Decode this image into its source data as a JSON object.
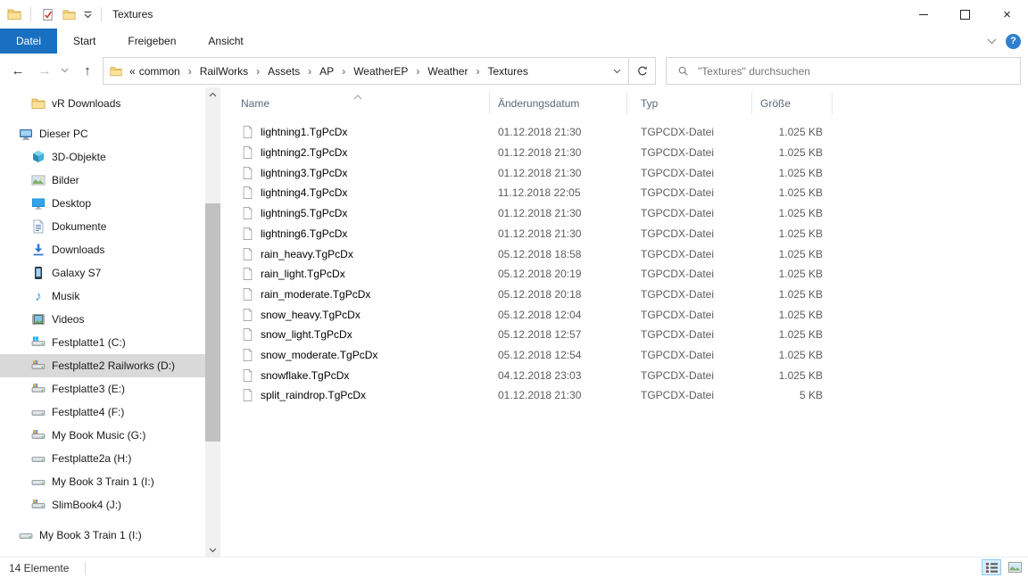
{
  "window": {
    "title": "Textures"
  },
  "ribbon": {
    "tabs": [
      {
        "label": "Datei",
        "active": true
      },
      {
        "label": "Start",
        "active": false
      },
      {
        "label": "Freigeben",
        "active": false
      },
      {
        "label": "Ansicht",
        "active": false
      }
    ]
  },
  "address": {
    "collapsed_indicator": "«",
    "crumbs": [
      "common",
      "RailWorks",
      "Assets",
      "AP",
      "WeatherEP",
      "Weather",
      "Textures"
    ],
    "search_placeholder": "\"Textures\" durchsuchen"
  },
  "sidebar": {
    "items": [
      {
        "label": "vR Downloads",
        "icon": "folder",
        "indent": 1,
        "gap": false,
        "selected": false
      },
      {
        "label": "Dieser PC",
        "icon": "pc",
        "indent": 0,
        "gap": true,
        "selected": false
      },
      {
        "label": "3D-Objekte",
        "icon": "cube",
        "indent": 1,
        "gap": false,
        "selected": false
      },
      {
        "label": "Bilder",
        "icon": "picture",
        "indent": 1,
        "gap": false,
        "selected": false
      },
      {
        "label": "Desktop",
        "icon": "desktop",
        "indent": 1,
        "gap": false,
        "selected": false
      },
      {
        "label": "Dokumente",
        "icon": "document",
        "indent": 1,
        "gap": false,
        "selected": false
      },
      {
        "label": "Downloads",
        "icon": "download",
        "indent": 1,
        "gap": false,
        "selected": false
      },
      {
        "label": "Galaxy S7",
        "icon": "phone",
        "indent": 1,
        "gap": false,
        "selected": false
      },
      {
        "label": "Musik",
        "icon": "music",
        "indent": 1,
        "gap": false,
        "selected": false
      },
      {
        "label": "Videos",
        "icon": "film",
        "indent": 1,
        "gap": false,
        "selected": false
      },
      {
        "label": "Festplatte1 (C:)",
        "icon": "drive-win",
        "indent": 1,
        "gap": false,
        "selected": false
      },
      {
        "label": "Festplatte2 Railworks (D:)",
        "icon": "drive-badge",
        "indent": 1,
        "gap": false,
        "selected": true
      },
      {
        "label": "Festplatte3 (E:)",
        "icon": "drive-badge",
        "indent": 1,
        "gap": false,
        "selected": false
      },
      {
        "label": "Festplatte4 (F:)",
        "icon": "drive",
        "indent": 1,
        "gap": false,
        "selected": false
      },
      {
        "label": "My Book Music (G:)",
        "icon": "drive-badge",
        "indent": 1,
        "gap": false,
        "selected": false
      },
      {
        "label": "Festplatte2a (H:)",
        "icon": "drive",
        "indent": 1,
        "gap": false,
        "selected": false
      },
      {
        "label": "My Book 3 Train 1 (I:)",
        "icon": "drive",
        "indent": 1,
        "gap": false,
        "selected": false
      },
      {
        "label": "SlimBook4 (J:)",
        "icon": "drive-badge",
        "indent": 1,
        "gap": false,
        "selected": false
      },
      {
        "label": "My Book 3 Train 1 (I:)",
        "icon": "drive",
        "indent": 0,
        "gap": true,
        "selected": false
      }
    ]
  },
  "list": {
    "columns": [
      "Name",
      "Änderungsdatum",
      "Typ",
      "Größe"
    ],
    "rows": [
      {
        "name": "lightning1.TgPcDx",
        "date": "01.12.2018 21:30",
        "type": "TGPCDX-Datei",
        "size": "1.025 KB"
      },
      {
        "name": "lightning2.TgPcDx",
        "date": "01.12.2018 21:30",
        "type": "TGPCDX-Datei",
        "size": "1.025 KB"
      },
      {
        "name": "lightning3.TgPcDx",
        "date": "01.12.2018 21:30",
        "type": "TGPCDX-Datei",
        "size": "1.025 KB"
      },
      {
        "name": "lightning4.TgPcDx",
        "date": "11.12.2018 22:05",
        "type": "TGPCDX-Datei",
        "size": "1.025 KB"
      },
      {
        "name": "lightning5.TgPcDx",
        "date": "01.12.2018 21:30",
        "type": "TGPCDX-Datei",
        "size": "1.025 KB"
      },
      {
        "name": "lightning6.TgPcDx",
        "date": "01.12.2018 21:30",
        "type": "TGPCDX-Datei",
        "size": "1.025 KB"
      },
      {
        "name": "rain_heavy.TgPcDx",
        "date": "05.12.2018 18:58",
        "type": "TGPCDX-Datei",
        "size": "1.025 KB"
      },
      {
        "name": "rain_light.TgPcDx",
        "date": "05.12.2018 20:19",
        "type": "TGPCDX-Datei",
        "size": "1.025 KB"
      },
      {
        "name": "rain_moderate.TgPcDx",
        "date": "05.12.2018 20:18",
        "type": "TGPCDX-Datei",
        "size": "1.025 KB"
      },
      {
        "name": "snow_heavy.TgPcDx",
        "date": "05.12.2018 12:04",
        "type": "TGPCDX-Datei",
        "size": "1.025 KB"
      },
      {
        "name": "snow_light.TgPcDx",
        "date": "05.12.2018 12:57",
        "type": "TGPCDX-Datei",
        "size": "1.025 KB"
      },
      {
        "name": "snow_moderate.TgPcDx",
        "date": "05.12.2018 12:54",
        "type": "TGPCDX-Datei",
        "size": "1.025 KB"
      },
      {
        "name": "snowflake.TgPcDx",
        "date": "04.12.2018 23:03",
        "type": "TGPCDX-Datei",
        "size": "1.025 KB"
      },
      {
        "name": "split_raindrop.TgPcDx",
        "date": "01.12.2018 21:30",
        "type": "TGPCDX-Datei",
        "size": "5 KB"
      }
    ]
  },
  "statusbar": {
    "count": "14 Elemente"
  }
}
